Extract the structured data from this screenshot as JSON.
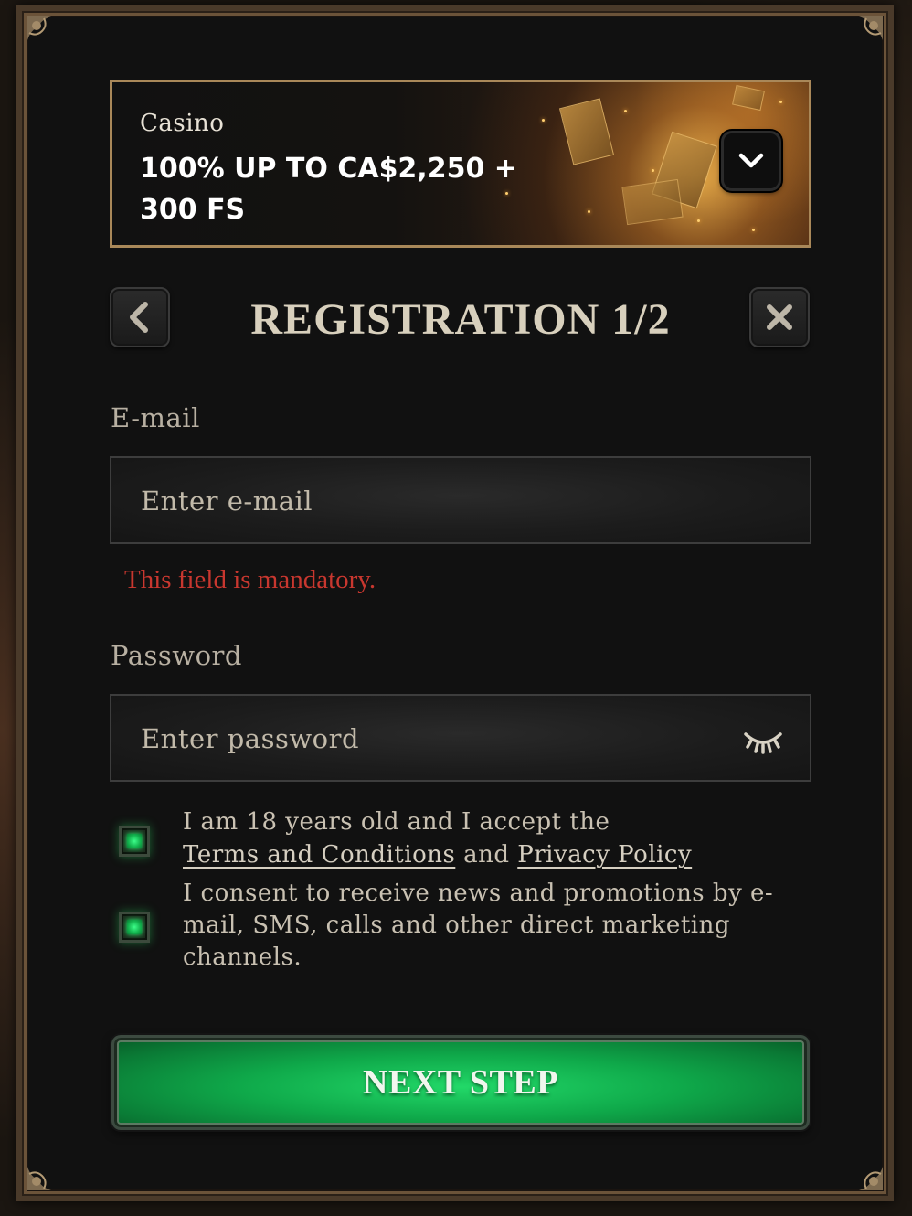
{
  "banner": {
    "category": "Casino",
    "headline": "100% UP TO CA$2,250 + 300 FS",
    "toggle_icon": "chevron-down-icon"
  },
  "header": {
    "title": "REGISTRATION 1/2",
    "back_icon": "chevron-left-icon",
    "close_icon": "close-icon"
  },
  "form": {
    "email": {
      "label": "E-mail",
      "placeholder": "Enter e-mail",
      "value": "",
      "error": "This field is mandatory."
    },
    "password": {
      "label": "Password",
      "placeholder": "Enter password",
      "value": "",
      "visibility_icon": "eye-closed-icon"
    }
  },
  "consents": {
    "terms": {
      "checked": true,
      "text_before": "I am 18 years old and I accept the",
      "terms_link": "Terms and Conditions",
      "conjunction": "and",
      "privacy_link": "Privacy Policy"
    },
    "marketing": {
      "checked": true,
      "text": "I consent to receive news and promotions by e-mail, SMS, calls and other direct marketing channels."
    }
  },
  "actions": {
    "next_label": "NEXT STEP"
  },
  "colors": {
    "accent_green": "#12b04c",
    "error_red": "#c8372f",
    "frame_gold": "#a98859",
    "panel_bg": "#111111"
  }
}
